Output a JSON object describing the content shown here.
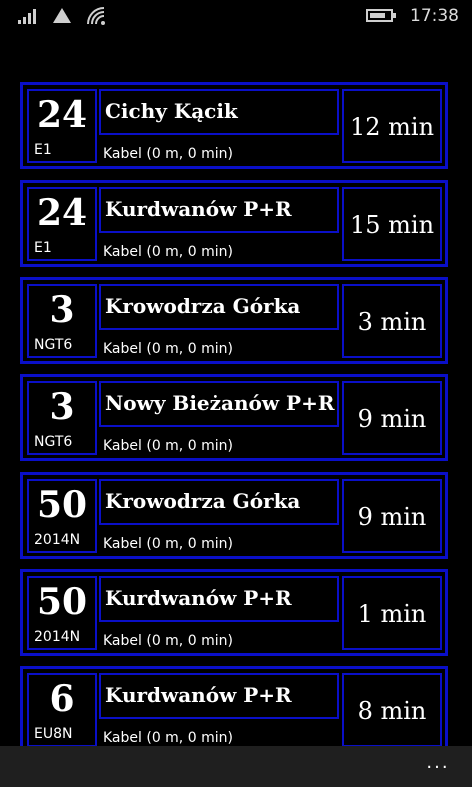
{
  "status_bar": {
    "icons": [
      "signal-strength-icon",
      "data-connection-icon",
      "wifi-icon",
      "battery-icon"
    ],
    "time": "17:38"
  },
  "departures": [
    {
      "line": "24",
      "vehicle": "E1",
      "destination": "Cichy Kącik",
      "info": "Kabel (0 m, 0 min)",
      "eta": "12 min"
    },
    {
      "line": "24",
      "vehicle": "E1",
      "destination": "Kurdwanów P+R",
      "info": "Kabel (0 m, 0 min)",
      "eta": "15 min"
    },
    {
      "line": "3",
      "vehicle": "NGT6",
      "destination": "Krowodrza Górka",
      "info": "Kabel (0 m, 0 min)",
      "eta": "3 min"
    },
    {
      "line": "3",
      "vehicle": "NGT6",
      "destination": "Nowy Bieżanów P+R",
      "info": "Kabel (0 m, 0 min)",
      "eta": "9 min"
    },
    {
      "line": "50",
      "vehicle": "2014N",
      "destination": "Krowodrza Górka",
      "info": "Kabel (0 m, 0 min)",
      "eta": "9 min"
    },
    {
      "line": "50",
      "vehicle": "2014N",
      "destination": "Kurdwanów P+R",
      "info": "Kabel (0 m, 0 min)",
      "eta": "1 min"
    },
    {
      "line": "6",
      "vehicle": "EU8N",
      "destination": "Kurdwanów P+R",
      "info": "Kabel (0 m, 0 min)",
      "eta": "8 min"
    }
  ],
  "app_bar": {
    "more_label": "..."
  },
  "colors": {
    "background": "#000000",
    "card_border": "#0a0fc8",
    "text": "#ffffff",
    "app_bar": "#1f1f1f"
  }
}
